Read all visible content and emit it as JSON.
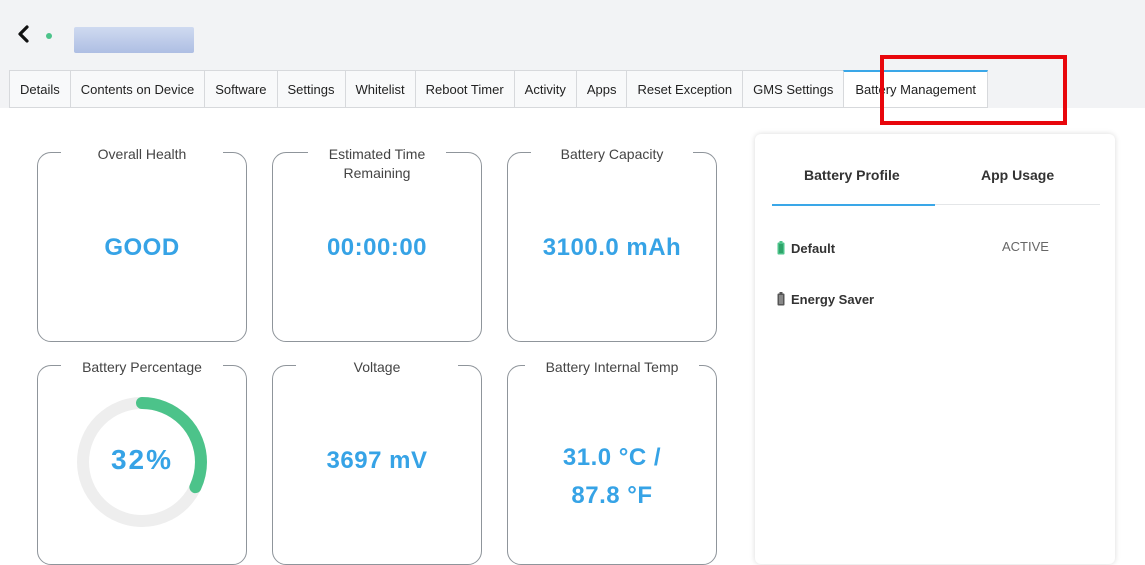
{
  "header": {
    "back_icon": "chevron-left-icon",
    "status_color": "#4cc38a"
  },
  "tabs": [
    {
      "label": "Details"
    },
    {
      "label": "Contents on Device"
    },
    {
      "label": "Software"
    },
    {
      "label": "Settings"
    },
    {
      "label": "Whitelist"
    },
    {
      "label": "Reboot Timer"
    },
    {
      "label": "Activity"
    },
    {
      "label": "Apps"
    },
    {
      "label": "Reset Exception"
    },
    {
      "label": "GMS Settings"
    },
    {
      "label": "Battery Management",
      "active": true
    }
  ],
  "cards": {
    "overall_health": {
      "title": "Overall Health",
      "value": "GOOD"
    },
    "time_remaining": {
      "title": "Estimated Time Remaining",
      "value": "00:00:00"
    },
    "capacity": {
      "title": "Battery Capacity",
      "value": "3100.0 mAh"
    },
    "percentage": {
      "title": "Battery Percentage",
      "value": "32%",
      "percent": 32
    },
    "voltage": {
      "title": "Voltage",
      "value": "3697 mV"
    },
    "temperature": {
      "title": "Battery Internal Temp",
      "value_line1": "31.0 °C /",
      "value_line2": "87.8 °F"
    }
  },
  "battery_panel": {
    "tabs": [
      {
        "label": "Battery Profile",
        "active": true
      },
      {
        "label": "App Usage"
      }
    ],
    "profiles": [
      {
        "name": "Default",
        "status": "ACTIVE",
        "icon_color": "#4cc38a"
      },
      {
        "name": "Energy Saver",
        "status": "",
        "icon_color": "#555555"
      }
    ]
  },
  "colors": {
    "accent": "#36a3e6",
    "gauge": "#4cc38a",
    "highlight": "#e8060c"
  }
}
